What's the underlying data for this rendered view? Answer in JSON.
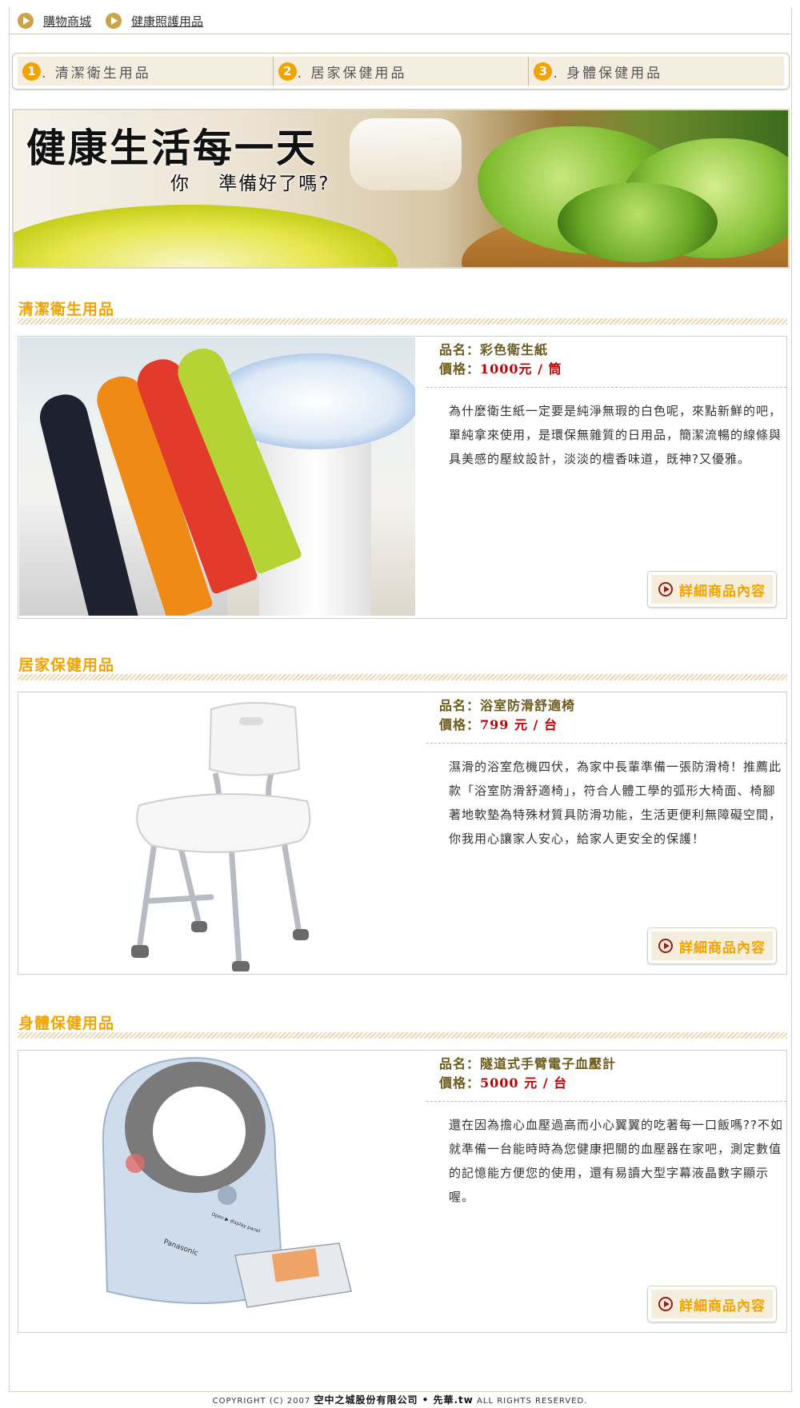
{
  "breadcrumb": {
    "items": [
      "購物商城",
      "健康照護用品"
    ]
  },
  "tabs": [
    {
      "num": "1",
      "label": ". 清潔衛生用品"
    },
    {
      "num": "2",
      "label": ". 居家保健用品"
    },
    {
      "num": "3",
      "label": ". 身體保健用品"
    }
  ],
  "banner": {
    "title": "健康生活每一天",
    "subtitle": "你 準備好了嗎?"
  },
  "sections": [
    {
      "title": "清潔衛生用品",
      "product": {
        "name_label": "品名：",
        "name": "彩色衛生紙",
        "price_label": "價格：",
        "price": "1000元 / 筒",
        "description": "為什麼衛生紙一定要是純淨無瑕的白色呢，來點新鮮的吧，單純拿來使用，是環保無雜質的日用品，簡潔流暢的線條與具美感的壓紋設計，淡淡的檀香味道，既神?又優雅。",
        "button": "詳細商品內容"
      }
    },
    {
      "title": "居家保健用品",
      "product": {
        "name_label": "品名：",
        "name": "浴室防滑舒適椅",
        "price_label": "價格：",
        "price": "799 元 / 台",
        "description": "濕滑的浴室危機四伏，為家中長輩準備一張防滑椅！推薦此款「浴室防滑舒適椅」，符合人體工學的弧形大椅面、椅腳著地軟墊為特殊材質具防滑功能，生活更便利無障礙空間，你我用心讓家人安心，給家人更安全的保護！",
        "button": "詳細商品內容"
      }
    },
    {
      "title": "身體保健用品",
      "product": {
        "name_label": "品名：",
        "name": "隧道式手臂電子血壓計",
        "price_label": "價格：",
        "price": "5000 元 / 台",
        "description": "還在因為擔心血壓過高而小心翼翼的吃著每一口飯嗎??不如就準備一台能時時為您健康把關的血壓器在家吧，測定數值的記憶能方便您的使用，還有易讀大型字幕液晶數字顯示喔。",
        "button": "詳細商品內容"
      }
    }
  ],
  "product_image_text": {
    "bp_brand": "Panasonic",
    "bp_button": "Open ▶ display panel"
  },
  "footer": {
    "prefix": "COPYRIGHT (C) 2007 ",
    "company": "空中之城股份有限公司 • 先華.tw",
    "suffix": " ALL RIGHTS RESERVED."
  },
  "colors": {
    "accent": "#f1a300",
    "price": "#c00000",
    "label": "#6d5b1c"
  },
  "icons": {
    "breadcrumb": "arrow-circle-icon",
    "button": "play-circle-icon"
  }
}
